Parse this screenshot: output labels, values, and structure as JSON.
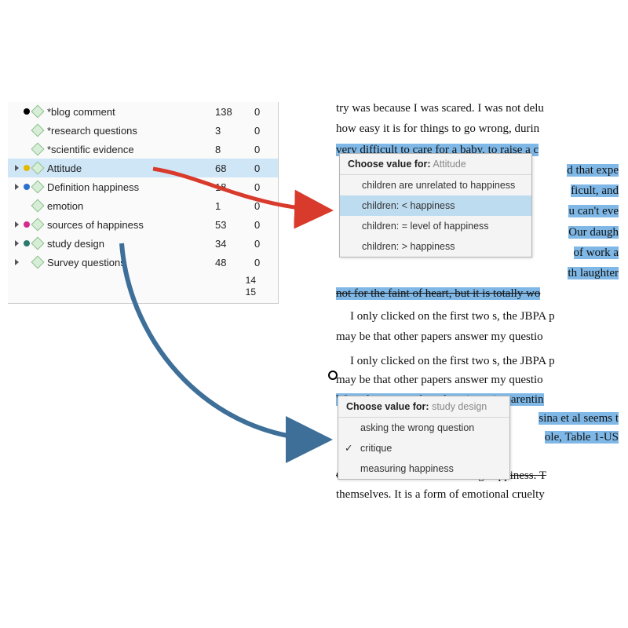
{
  "codes": [
    {
      "expand": false,
      "dot": "#000000",
      "label": "*blog comment",
      "n": 138,
      "z": 0,
      "hl": false
    },
    {
      "expand": false,
      "dot": "",
      "label": "*research questions",
      "n": 3,
      "z": 0,
      "hl": false
    },
    {
      "expand": false,
      "dot": "",
      "label": "*scientific evidence",
      "n": 8,
      "z": 0,
      "hl": false
    },
    {
      "expand": true,
      "dot": "#e6b800",
      "label": "Attitude",
      "n": 68,
      "z": 0,
      "hl": true
    },
    {
      "expand": true,
      "dot": "#2b6fd1",
      "label": "Definition happiness",
      "n": 18,
      "z": 0,
      "hl": false
    },
    {
      "expand": false,
      "dot": "",
      "label": "emotion",
      "n": 1,
      "z": 0,
      "hl": false
    },
    {
      "expand": true,
      "dot": "#d62b8e",
      "label": "sources of happiness",
      "n": 53,
      "z": 0,
      "hl": false
    },
    {
      "expand": true,
      "dot": "#2b7a6e",
      "label": "study design",
      "n": 34,
      "z": 0,
      "hl": false
    },
    {
      "expand": true,
      "dot": "",
      "label": "Survey questions",
      "n": 48,
      "z": 0,
      "hl": false
    }
  ],
  "footer_nums": [
    "14",
    "15"
  ],
  "arrow_colors": {
    "red": "#d83a2b",
    "blue": "#3d6f99"
  },
  "doc1": {
    "l1a": "try was because I was scared. I was not delu",
    "l1b": "how easy it is for things to go wrong, durin",
    "hl1": "very difficult to care for a baby, to raise a c",
    "l2a": "d that expe",
    "l2b": "ficult, and",
    "l2c": "u can't eve",
    "l3a": "Our daugh",
    "l3b": "of work a",
    "l3c": "th laughter",
    "hl2": "not for the faint of heart, but it is totally wo",
    "p2a": "I only clicked on the first two s, the JBPA p",
    "p2b": "may be that other papers answer my questio"
  },
  "menu1": {
    "hdr_label": "Choose value for:",
    "hdr_val": "Attitude",
    "items": [
      {
        "text": "children are unrelated to happiness",
        "sel": false,
        "check": false
      },
      {
        "text": "children: < happiness",
        "sel": true,
        "check": false
      },
      {
        "text": "children: = level of happiness",
        "sel": false,
        "check": false
      },
      {
        "text": "children: > happiness",
        "sel": false,
        "check": false
      }
    ]
  },
  "doc2": {
    "p1a": "I only clicked on the first two s, the JBPA p",
    "p1b": "may be that other papers answer my questio",
    "hl1": "Were the papers about happiness in parentin",
    "l2a": "sina et al seems t",
    "l2b": "ole, Table 1-US",
    "dots": "……..",
    "p3a": "Of course children do not bring happiness. T",
    "p3b": "themselves. It is a form of emotional cruelty"
  },
  "menu2": {
    "hdr_label": "Choose value for:",
    "hdr_val": "study design",
    "items": [
      {
        "text": "asking the wrong question",
        "sel": false,
        "check": false
      },
      {
        "text": "critique",
        "sel": false,
        "check": true
      },
      {
        "text": "measuring happiness",
        "sel": false,
        "check": false
      }
    ]
  }
}
